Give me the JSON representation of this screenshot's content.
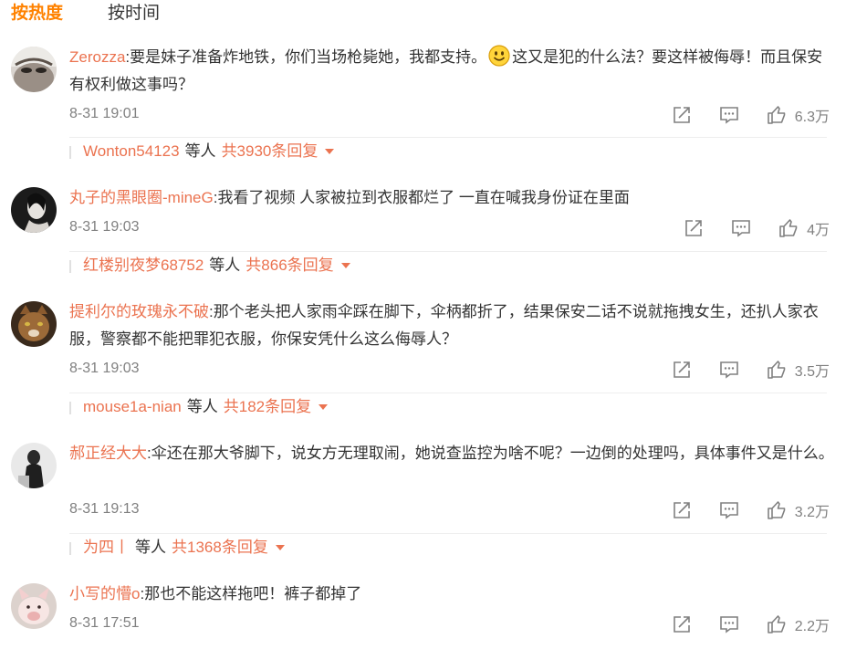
{
  "tabs": {
    "hot": "按热度",
    "time": "按时间"
  },
  "comments": [
    {
      "user": "Zerozza",
      "text_before": ":要是妹子准备炸地铁，你们当场枪毙她，我都支持。",
      "emoji": "smile-emoji",
      "text_after": "这又是犯的什么法？要这样被侮辱！而且保安有权利做这事吗？",
      "time": "8-31 19:01",
      "likes": "6.3万",
      "reply_user": "Wonton54123",
      "reply_mid": "等人",
      "reply_count": "共3930条回复"
    },
    {
      "user": "丸子的黑眼圈-mineG",
      "text_before": ":我看了视频 人家被拉到衣服都烂了 一直在喊我身份证在里面",
      "text_after": "",
      "time": "8-31 19:03",
      "likes": "4万",
      "reply_user": "红楼别夜梦68752",
      "reply_mid": "等人",
      "reply_count": "共866条回复"
    },
    {
      "user": "提利尔的玫瑰永不破",
      "text_before": ":那个老头把人家雨伞踩在脚下，伞柄都折了，结果保安二话不说就拖拽女生，还扒人家衣服，警察都不能把罪犯衣服，你保安凭什么这么侮辱人？",
      "text_after": "",
      "time": "8-31 19:03",
      "likes": "3.5万",
      "reply_user": "mouse1a-nian",
      "reply_mid": "等人",
      "reply_count": "共182条回复"
    },
    {
      "user": "郝正经大大",
      "text_before": ":伞还在那大爷脚下，说女方无理取闹，她说查监控为啥不呢？一边倒的处理吗，具体事件又是什么。",
      "text_after": "",
      "time": "8-31 19:13",
      "likes": "3.2万",
      "reply_user": "为四丨",
      "reply_mid": "等人",
      "reply_count": "共1368条回复"
    },
    {
      "user": "小写的懵o",
      "text_before": ":那也不能这样拖吧！裤子都掉了",
      "text_after": "",
      "time": "8-31 17:51",
      "likes": "2.2万"
    }
  ],
  "colors": {
    "accent": "#ff8200",
    "username": "#eb7350",
    "meta": "#808080"
  }
}
